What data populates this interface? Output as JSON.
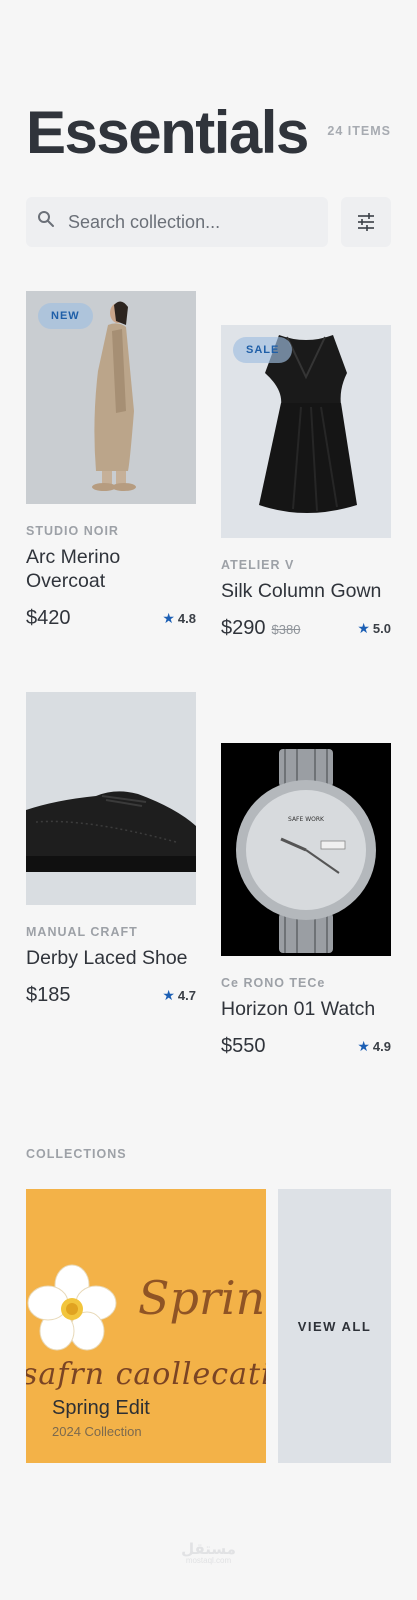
{
  "header": {
    "title": "Essentials",
    "item_count": "24 ITEMS"
  },
  "search": {
    "placeholder": "Search collection..."
  },
  "icons": {
    "search": "search-icon",
    "filter": "sliders-icon",
    "rating": "star-icon"
  },
  "colors": {
    "accent": "#1c5fb4",
    "badge_bg": "#a0bee1",
    "collection_bg": "#f3b248",
    "view_all_bg": "#dde1e6"
  },
  "products": [
    {
      "badge": "NEW",
      "brand": "STUDIO NOIR",
      "name": "Arc Merino Overcoat",
      "price": "$420",
      "old_price": "",
      "rating": "4.8"
    },
    {
      "badge": "SALE",
      "brand": "ATELIER V",
      "name": "Silk Column Gown",
      "price": "$290",
      "old_price": "$380",
      "rating": "5.0"
    },
    {
      "badge": "",
      "brand": "MANUAL CRAFT",
      "name": "Derby Laced Shoe",
      "price": "$185",
      "old_price": "",
      "rating": "4.7"
    },
    {
      "badge": "",
      "brand": "Ce RONO TECe",
      "name": "Horizon 01 Watch",
      "price": "$550",
      "old_price": "",
      "rating": "4.9"
    }
  ],
  "watch_dial_text": "SAFE WORK",
  "collections": {
    "label": "COLLECTIONS",
    "featured": {
      "art_word": "Spring",
      "art_text": "safrn caollecation",
      "title": "Spring Edit",
      "subtitle": "2024 Collection"
    },
    "view_all_label": "VIEW ALL"
  },
  "watermark": {
    "logo": "مستقل",
    "domain": "mostaql.com"
  }
}
